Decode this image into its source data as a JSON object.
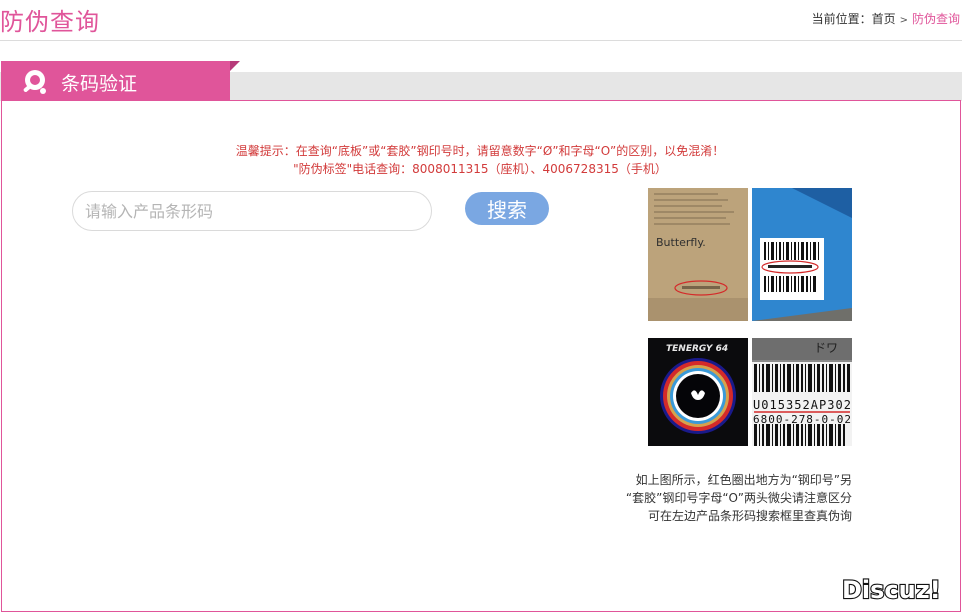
{
  "page_title": "防伪查询",
  "breadcrumb": {
    "prefix": "当前位置：",
    "home": "首页",
    "separator": ">",
    "current": "防伪查询"
  },
  "tab": {
    "label": "条码验证",
    "icon": "ping-pong-icon"
  },
  "tips": {
    "line1": "温馨提示：在查询“底板”或“套胶”钢印号时，请留意数字“Ø”和字母“O”的区别，以免混淆！",
    "line2": "\"防伪标签\"电话查询：8008011315（座机）、4006728315（手机）"
  },
  "search": {
    "placeholder": "请输入产品条形码",
    "value": "",
    "button_label": "搜索"
  },
  "thumbnails": {
    "blade_text": "Butterfly.",
    "rubber_text": "TENERGY 64",
    "code_text": "U015352AP302",
    "code_text_2": "6800-278-0-02",
    "box_text": "ドワ"
  },
  "caption": {
    "line1": "如上图所示，红色圈出地方为“钢印号”另",
    "line2": "“套胶”钢印号字母“O”两头微尖请注意区分",
    "line3": "可在左边产品条形码搜索框里查真伪询"
  },
  "watermark": "Discuz!",
  "colors": {
    "accent": "#e0559a",
    "button": "#7aa7e2",
    "tips": "#d23b3b"
  }
}
